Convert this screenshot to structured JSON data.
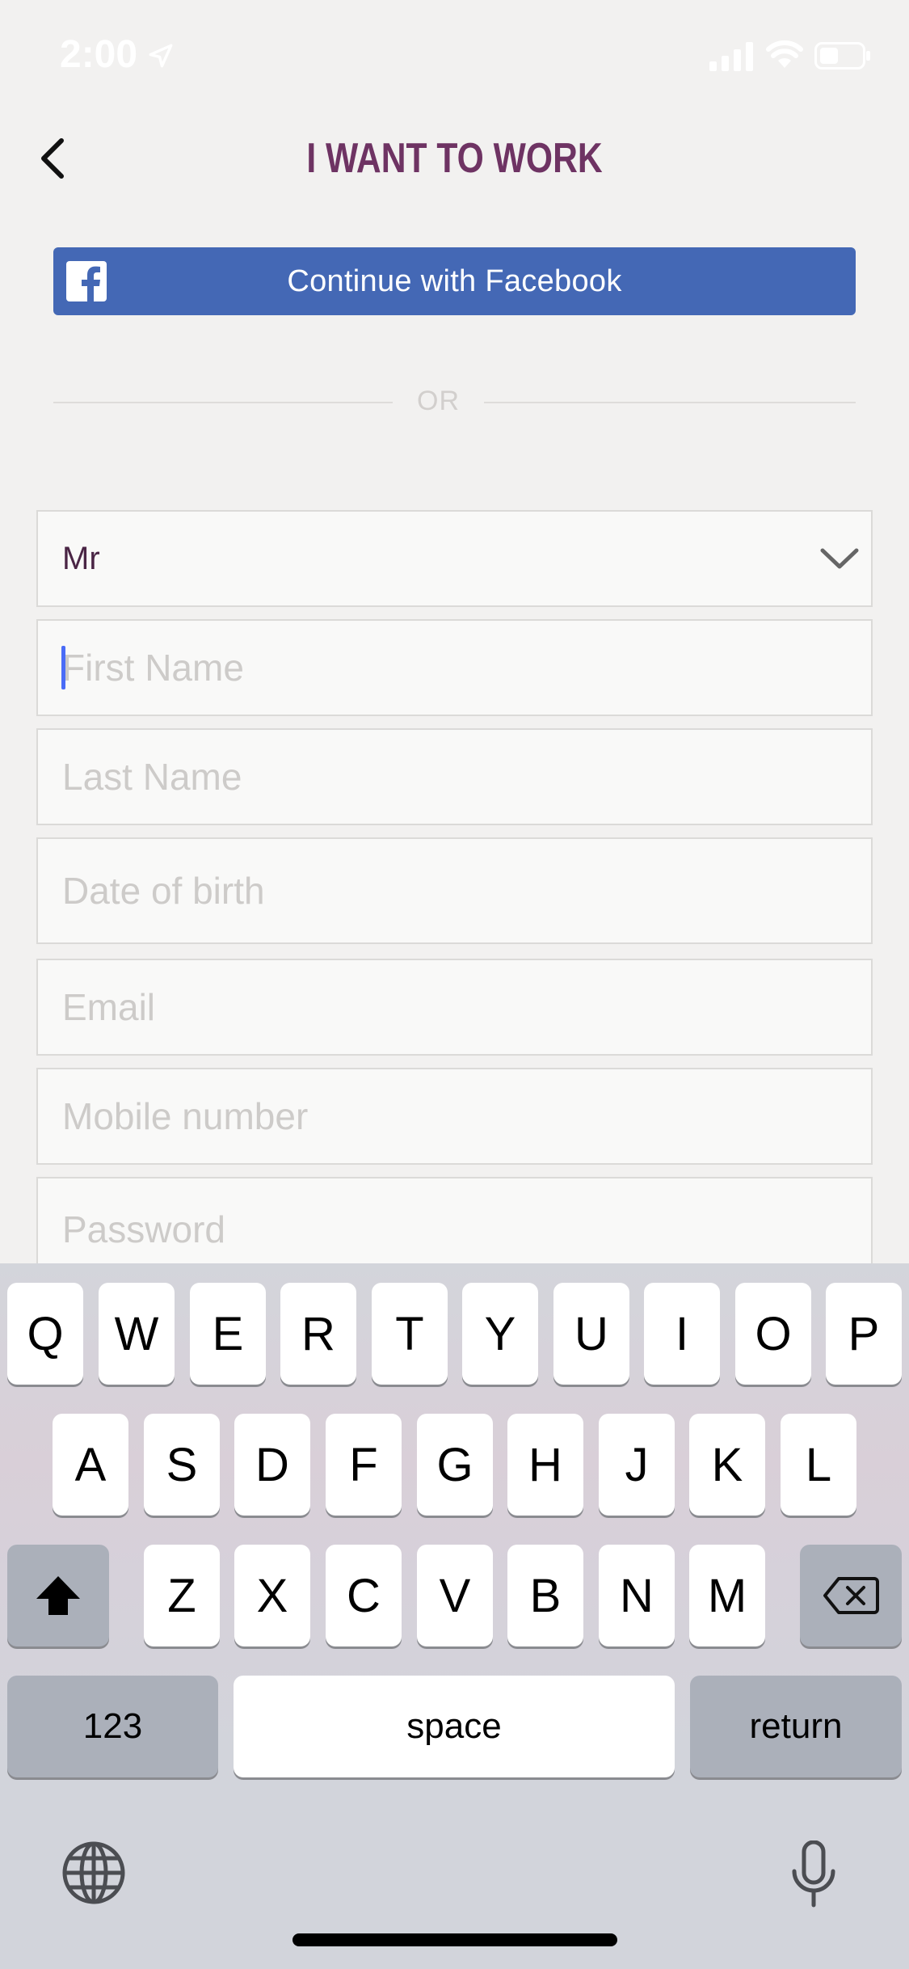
{
  "status_bar": {
    "time": "2:00",
    "icons": [
      "location-arrow-icon",
      "signal-icon",
      "wifi-icon",
      "battery-icon"
    ]
  },
  "header": {
    "title": "I WANT TO WORK",
    "back_icon": "chevron-left-icon"
  },
  "facebook": {
    "label": "Continue with Facebook",
    "icon": "facebook-icon"
  },
  "divider": {
    "text": "OR"
  },
  "form": {
    "title_select": {
      "value": "Mr",
      "icon": "chevron-down-icon"
    },
    "first_name": {
      "placeholder": "First Name",
      "value": ""
    },
    "last_name": {
      "placeholder": "Last Name",
      "value": ""
    },
    "date_of_birth": {
      "placeholder": "Date of birth",
      "value": ""
    },
    "email": {
      "placeholder": "Email",
      "value": ""
    },
    "mobile": {
      "placeholder": "Mobile number",
      "value": ""
    },
    "password": {
      "placeholder": "Password",
      "value": ""
    }
  },
  "keyboard": {
    "row1": [
      "Q",
      "W",
      "E",
      "R",
      "T",
      "Y",
      "U",
      "I",
      "O",
      "P"
    ],
    "row2": [
      "A",
      "S",
      "D",
      "F",
      "G",
      "H",
      "J",
      "K",
      "L"
    ],
    "row3": [
      "Z",
      "X",
      "C",
      "V",
      "B",
      "N",
      "M"
    ],
    "numbers_label": "123",
    "space_label": "space",
    "return_label": "return",
    "shift_icon": "shift-icon",
    "delete_icon": "backspace-icon",
    "globe_icon": "globe-icon",
    "mic_icon": "microphone-icon"
  },
  "colors": {
    "title": "#6e3363",
    "facebook": "#4468b5",
    "caret": "#4a6cf7",
    "background": "#f2f1f0"
  }
}
